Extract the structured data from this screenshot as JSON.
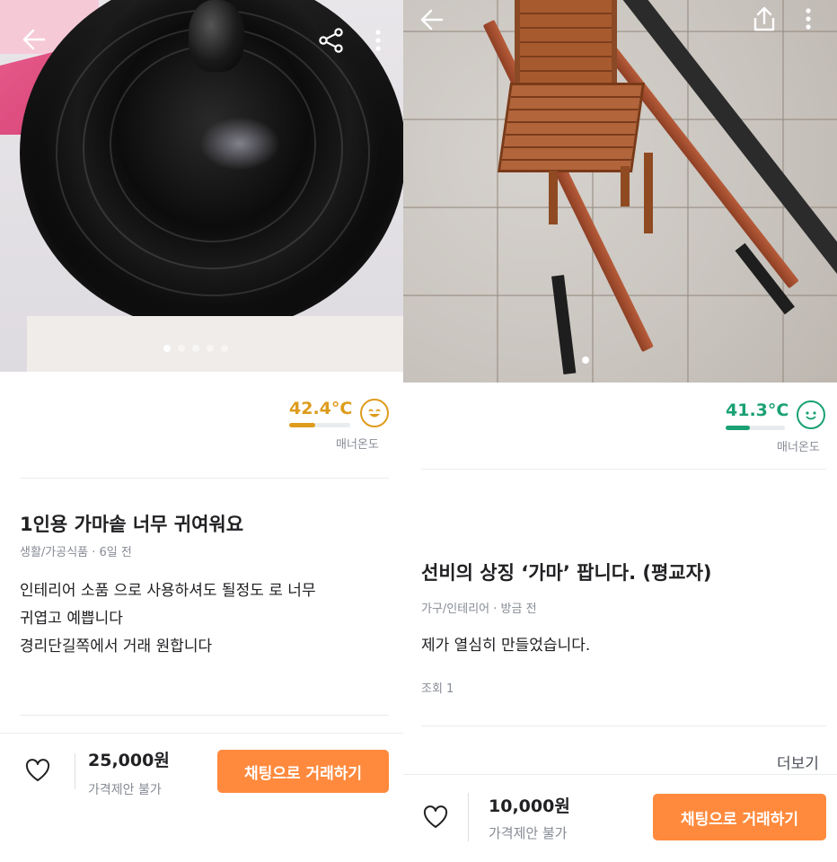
{
  "left": {
    "icons": {
      "back": "back-arrow-icon",
      "share": "share-icon",
      "menu": "more-vertical-icon"
    },
    "temperature": {
      "value": "42.4°C",
      "label": "매너온도",
      "fill_fraction": 0.42,
      "color": "#de9c1c"
    },
    "title": "1인용 가마솥 너무 귀여워요",
    "meta": "생활/가공식품 · 6일 전",
    "description": [
      "인테리어 소품 으로 사용하셔도 될정도 로 너무",
      "귀엽고 예쁩니다",
      "경리단길쪽에서 거래 원합니다"
    ],
    "price": "25,000원",
    "negotiation": "가격제안 불가",
    "cta": "채팅으로 거래하기",
    "carousel": {
      "count": 5,
      "active": 0
    }
  },
  "right": {
    "icons": {
      "back": "back-arrow-icon",
      "share": "share-upload-icon",
      "menu": "more-vertical-icon"
    },
    "temperature": {
      "value": "41.3°C",
      "label": "매너온도",
      "fill_fraction": 0.41,
      "color": "#1aa174"
    },
    "title": "선비의 상징 ‘가마’ 팝니다. (평교자)",
    "meta": "가구/인테리어 · 방금 전",
    "description": [
      "제가 열심히 만들었습니다."
    ],
    "views": "조회 1",
    "more": "더보기",
    "price": "10,000원",
    "negotiation": "가격제안 불가",
    "cta": "채팅으로 거래하기",
    "carousel": {
      "count": 1,
      "active": 0
    }
  }
}
